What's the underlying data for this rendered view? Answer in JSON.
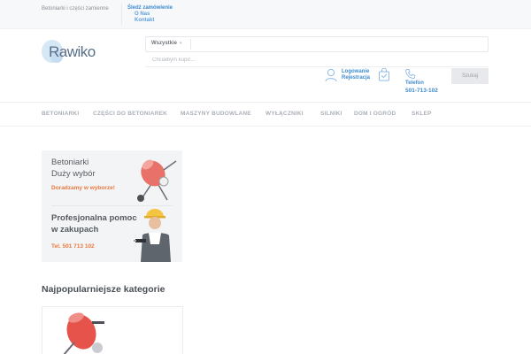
{
  "topbar": {
    "tagline": "Betoniarki i części zamienne",
    "links": [
      "Śledź zamówienie",
      "O Nas",
      "Kontakt"
    ]
  },
  "header": {
    "logo_text": "Rawiko",
    "category_select": "Wszystkie",
    "search_placeholder": "Chciałbym kupić...",
    "account_login": "Logowanie",
    "account_register": "Rejestracja",
    "phone_label": "Telefon",
    "phone_number": "501-713-102",
    "search_button": "Szukaj"
  },
  "nav": {
    "items": [
      "BETONIARKI",
      "CZĘŚCI DO BETONIAREK",
      "MASZYNY BUDOWLANE",
      "WYŁĄCZNIKI",
      "SILNIKI",
      "DOM I OGRÓD",
      "SKLEP"
    ]
  },
  "banner": {
    "top_line1": "Betoniarki",
    "top_line2": "Duży wybór",
    "top_cta": "Doradzamy w wyborze!",
    "bottom_line1": "Profesjonalna pomoc",
    "bottom_line2": "w zakupach",
    "bottom_phone": "Tel. 501 713 102"
  },
  "popular": {
    "title": "Najpopularniejsze kategorie"
  },
  "colors": {
    "accent_blue": "#3f8bd1",
    "accent_orange": "#e9793f",
    "mixer_red": "#e5534b"
  }
}
